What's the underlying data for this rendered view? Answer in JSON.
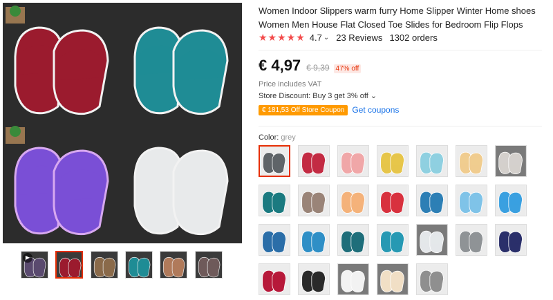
{
  "product": {
    "title": "Women Indoor Slippers warm furry Home Slipper Winter Home shoes Women Men House Flat Closed Toe Slides for Bedroom Flip Flops",
    "stars": "★★★★★",
    "rating": "4.7",
    "reviews": "23 Reviews",
    "orders": "1302 orders",
    "price": "€ 4,97",
    "old_price": "€ 9,39",
    "discount": "47% off",
    "vat": "Price includes VAT",
    "store_discount": "Store Discount: Buy 3 get 3% off ⌄",
    "coupon": "€ 181,53 Off Store Coupon",
    "get_coupons": "Get coupons",
    "color_label": "Color:",
    "color_value": "grey"
  },
  "icons": {
    "rating_dropdown": "chevron-down-icon",
    "play": "play-icon"
  },
  "colors": {
    "accent": "#e62e04",
    "coupon": "#ff9a00",
    "link": "#1a73e8"
  },
  "main_image_slippers": [
    "#9b1b2e",
    "#1f8c95",
    "#7a4fd6",
    "#e8eaeb"
  ],
  "thumbnails": [
    {
      "color": "#5a4a6f"
    },
    {
      "color": "#9b1b2e"
    },
    {
      "color": "#8a6a4a"
    },
    {
      "color": "#1f8c95"
    },
    {
      "color": "#b07a5b"
    },
    {
      "color": "#6f5a5a"
    }
  ],
  "swatches": [
    "#5f6468",
    "#c32b43",
    "#f0a7a8",
    "#e6c54a",
    "#8fd0e0",
    "#f0cc8f",
    "#d4d0cc",
    "#1b7a80",
    "#9a8478",
    "#f4b27a",
    "#d8313e",
    "#2d7fb5",
    "#7fc3e8",
    "#3aa0e0",
    "#2b6ea8",
    "#2f8fc6",
    "#1f6e7a",
    "#2799b3",
    "#e4e7ea",
    "#8f9396",
    "#2a2f6a",
    "#b7193a",
    "#2a2a2a",
    "#f2f2f2",
    "#f1dfc5",
    "#8f8f8f"
  ]
}
